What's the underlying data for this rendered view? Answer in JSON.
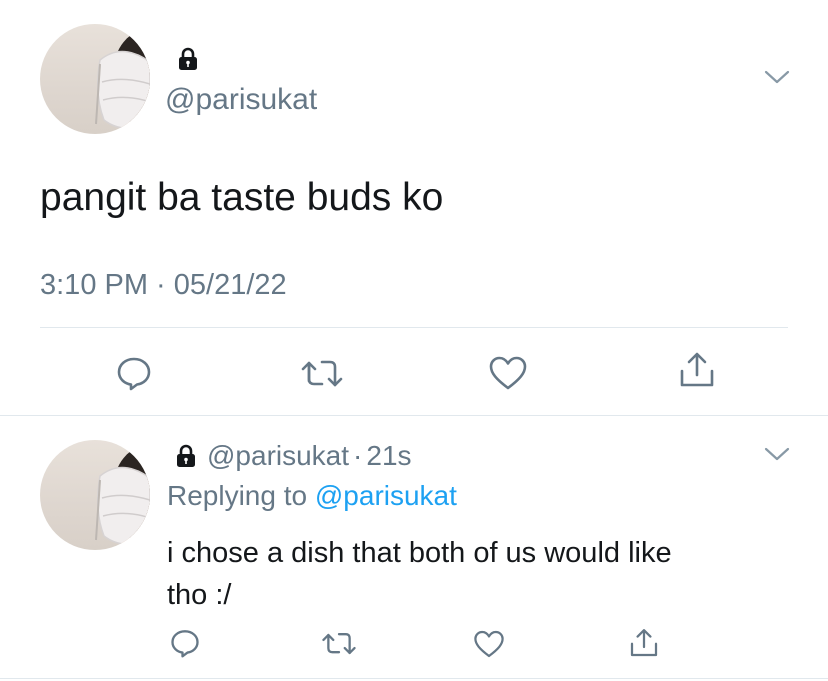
{
  "main_tweet": {
    "handle": "@parisukat",
    "text": "pangit ba taste buds ko",
    "timestamp": "3:10 PM · 05/21/22",
    "locked": true
  },
  "reply_tweet": {
    "handle": "@parisukat",
    "separator": "·",
    "age": "21s",
    "replying_prefix": "Replying to ",
    "replying_to": "@parisukat",
    "text_line1": "i chose a dish that both of us would like",
    "text_line2": "tho :/",
    "locked": true
  },
  "actions": [
    "reply-icon",
    "retweet-icon",
    "like-icon",
    "share-icon"
  ],
  "colors": {
    "text": "#14171a",
    "secondary": "#657786",
    "link": "#1da1f2",
    "divider": "#e1e8ed"
  }
}
